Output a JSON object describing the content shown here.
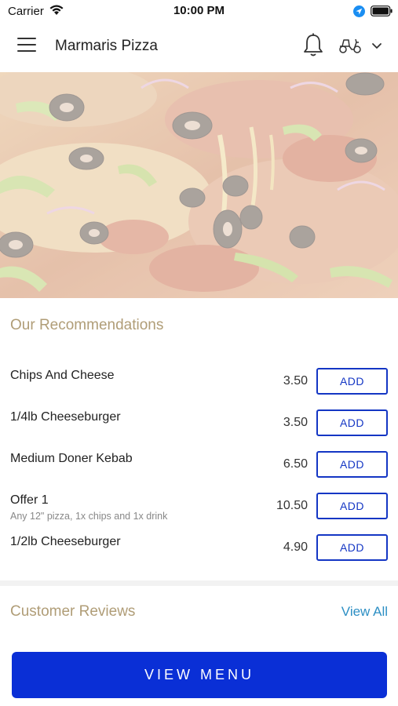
{
  "status_bar": {
    "carrier": "Carrier",
    "time": "10:00 PM"
  },
  "header": {
    "title": "Marmaris Pizza",
    "icons": [
      "menu-icon",
      "bell-icon",
      "scooter-icon",
      "chevron-down-icon"
    ]
  },
  "recommendations": {
    "title": "Our Recommendations",
    "items": [
      {
        "name": "Chips And Cheese",
        "description": "",
        "price": "3.50",
        "button": "ADD"
      },
      {
        "name": "1/4lb Cheeseburger",
        "description": "",
        "price": "3.50",
        "button": "ADD"
      },
      {
        "name": "Medium Doner Kebab",
        "description": "",
        "price": "6.50",
        "button": "ADD"
      },
      {
        "name": "Offer 1",
        "description": "Any 12\" pizza, 1x chips and 1x drink",
        "price": "10.50",
        "button": "ADD"
      },
      {
        "name": "1/2lb Cheeseburger",
        "description": "",
        "price": "4.90",
        "button": "ADD"
      }
    ]
  },
  "reviews": {
    "title": "Customer Reviews",
    "view_all": "View All"
  },
  "cta": {
    "label": "VIEW MENU"
  },
  "colors": {
    "accent_button": "#0a2fd6",
    "add_outline": "#1436c4",
    "section_title": "#b09d77",
    "link": "#2d8fc4"
  }
}
